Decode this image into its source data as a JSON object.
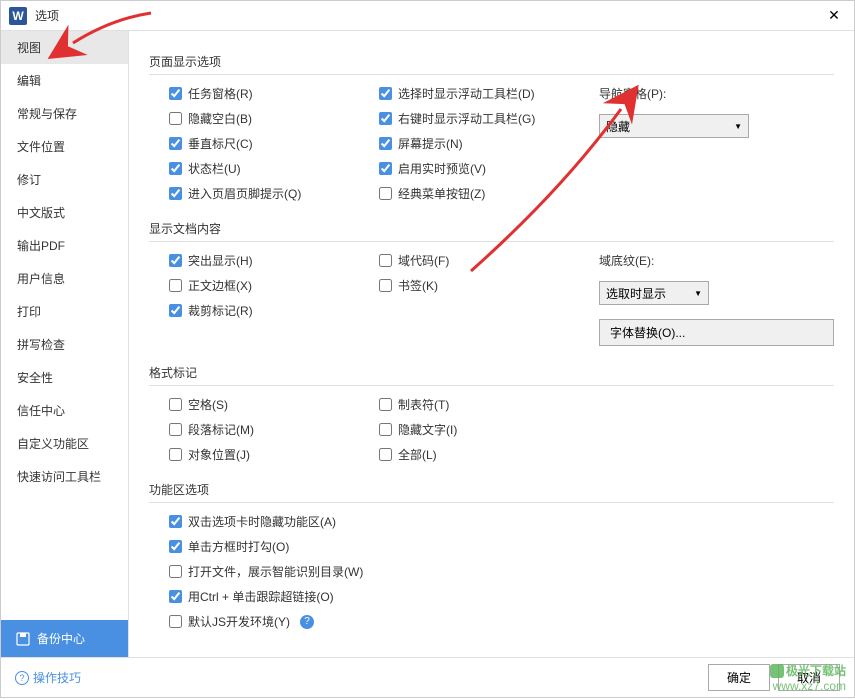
{
  "titlebar": {
    "title": "选项"
  },
  "sidebar": {
    "items": [
      "视图",
      "编辑",
      "常规与保存",
      "文件位置",
      "修订",
      "中文版式",
      "输出PDF",
      "用户信息",
      "打印",
      "拼写检查",
      "安全性",
      "信任中心",
      "自定义功能区",
      "快速访问工具栏"
    ],
    "backup_center": "备份中心"
  },
  "sections": {
    "page_display": {
      "title": "页面显示选项",
      "col1": [
        {
          "label": "任务窗格(R)",
          "checked": true
        },
        {
          "label": "隐藏空白(B)",
          "checked": false
        },
        {
          "label": "垂直标尺(C)",
          "checked": true
        },
        {
          "label": "状态栏(U)",
          "checked": true
        },
        {
          "label": "进入页眉页脚提示(Q)",
          "checked": true
        }
      ],
      "col2": [
        {
          "label": "选择时显示浮动工具栏(D)",
          "checked": true
        },
        {
          "label": "右键时显示浮动工具栏(G)",
          "checked": true
        },
        {
          "label": "屏幕提示(N)",
          "checked": true
        },
        {
          "label": "启用实时预览(V)",
          "checked": true
        },
        {
          "label": "经典菜单按钮(Z)",
          "checked": false
        }
      ],
      "nav_pane_label": "导航窗格(P):",
      "nav_pane_value": "隐藏"
    },
    "doc_content": {
      "title": "显示文档内容",
      "col1": [
        {
          "label": "突出显示(H)",
          "checked": true
        },
        {
          "label": "正文边框(X)",
          "checked": false
        },
        {
          "label": "裁剪标记(R)",
          "checked": true
        }
      ],
      "col2": [
        {
          "label": "域代码(F)",
          "checked": false
        },
        {
          "label": "书签(K)",
          "checked": false
        }
      ],
      "shading_label": "域底纹(E):",
      "shading_value": "选取时显示",
      "font_sub_btn": "字体替换(O)..."
    },
    "format_marks": {
      "title": "格式标记",
      "col1": [
        {
          "label": "空格(S)",
          "checked": false
        },
        {
          "label": "段落标记(M)",
          "checked": false
        },
        {
          "label": "对象位置(J)",
          "checked": false
        }
      ],
      "col2": [
        {
          "label": "制表符(T)",
          "checked": false
        },
        {
          "label": "隐藏文字(I)",
          "checked": false
        },
        {
          "label": "全部(L)",
          "checked": false
        }
      ]
    },
    "ribbon": {
      "title": "功能区选项",
      "items": [
        {
          "label": "双击选项卡时隐藏功能区(A)",
          "checked": true
        },
        {
          "label": "单击方框时打勾(O)",
          "checked": true
        },
        {
          "label": "打开文件，展示智能识别目录(W)",
          "checked": false
        },
        {
          "label": "用Ctrl + 单击跟踪超链接(O)",
          "checked": true
        },
        {
          "label": "默认JS开发环境(Y)",
          "checked": false,
          "info": true
        }
      ]
    }
  },
  "footer": {
    "tips": "操作技巧",
    "ok": "确定",
    "cancel": "取消"
  },
  "watermark": {
    "line1": "极光下载站",
    "line2": "www.xz7.com"
  }
}
